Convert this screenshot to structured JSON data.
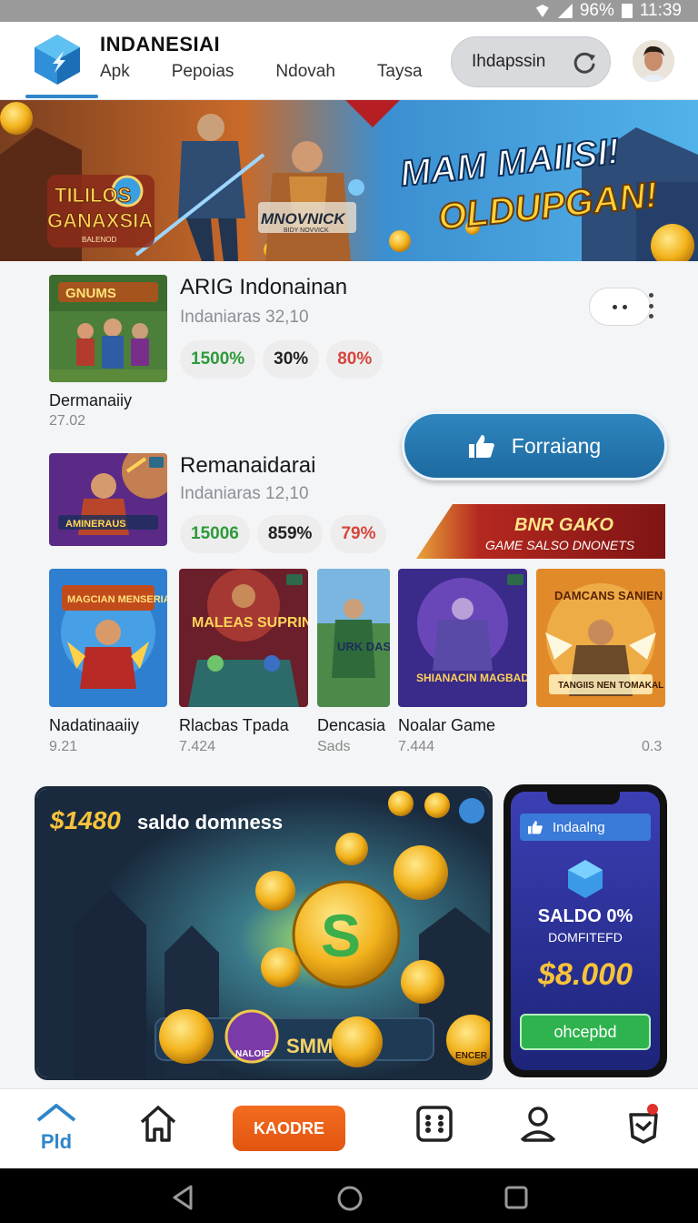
{
  "status": {
    "battery": "96%",
    "time": "11:39"
  },
  "header": {
    "app_title": "INDANESIAI",
    "tabs": [
      {
        "label": "Apk"
      },
      {
        "label": "Pepoias"
      },
      {
        "label": "Ndovah"
      },
      {
        "label": "Taysa"
      }
    ],
    "search_label": "Ihdapssin"
  },
  "banner": {
    "left_logo": "TILILOS GANAXSIA",
    "left_logo_small": "BALENOD",
    "center_logo": "MNOVNICK",
    "center_logo_small": "BIDY NOVVICK",
    "headline_1": "MAM MAIISI!",
    "headline_2": "OLDUPGAN!"
  },
  "list": [
    {
      "title": "ARIG Indonainan",
      "subtitle": "Indaniaras 32,10",
      "stats": [
        "1500%",
        "30%",
        "80%"
      ],
      "label": "Dermanaiiy",
      "number": "27.02",
      "thumb_text": "GNUMS"
    },
    {
      "title": "Remanaidarai",
      "subtitle": "Indaniaras 12,10",
      "stats": [
        "15006",
        "859%",
        "79%"
      ],
      "thumb_text": "AMINERAUS"
    }
  ],
  "cta": {
    "label": "Forraiang"
  },
  "promo_tag": {
    "line1": "BNR GAKO",
    "line2": "GAME SALSO DNONETS"
  },
  "grid": [
    {
      "art": "MAGCIAN MENSERIA",
      "title": "Nadatinaaiiy",
      "number": "9.21"
    },
    {
      "art": "MALEAS SUPRINNT",
      "title": "Rlacbas Tpada",
      "number": "7.424"
    },
    {
      "art": "URK DASI",
      "title": "Dencasia",
      "number": "Sads"
    },
    {
      "art": "SHIANACIN MAGBADBANINT",
      "title": "Noalar Game",
      "number": "7.444"
    },
    {
      "art": "DAMCANS SANIEN",
      "art2": "TANGIIS NEN TOMAKAL",
      "title": "",
      "number": "0.3"
    }
  ],
  "promo_big": {
    "amount": "$1480",
    "text": "saldo domness",
    "bar_text": "SMM",
    "badge_left": "NALOIE",
    "badge_right": "ENCER"
  },
  "phone_card": {
    "chip": "Indaalng",
    "line1": "SALDO 0%",
    "line2": "DOMFITEFD",
    "amount": "$8.000",
    "button": "ohcepbd"
  },
  "bottom_nav": {
    "home_label": "Pld",
    "cta_label": "KAODRE"
  },
  "colors": {
    "accent": "#2f86c9",
    "cta_orange": "#f36c1f",
    "stat_green": "#2e9a3a",
    "stat_red": "#d7453a"
  }
}
